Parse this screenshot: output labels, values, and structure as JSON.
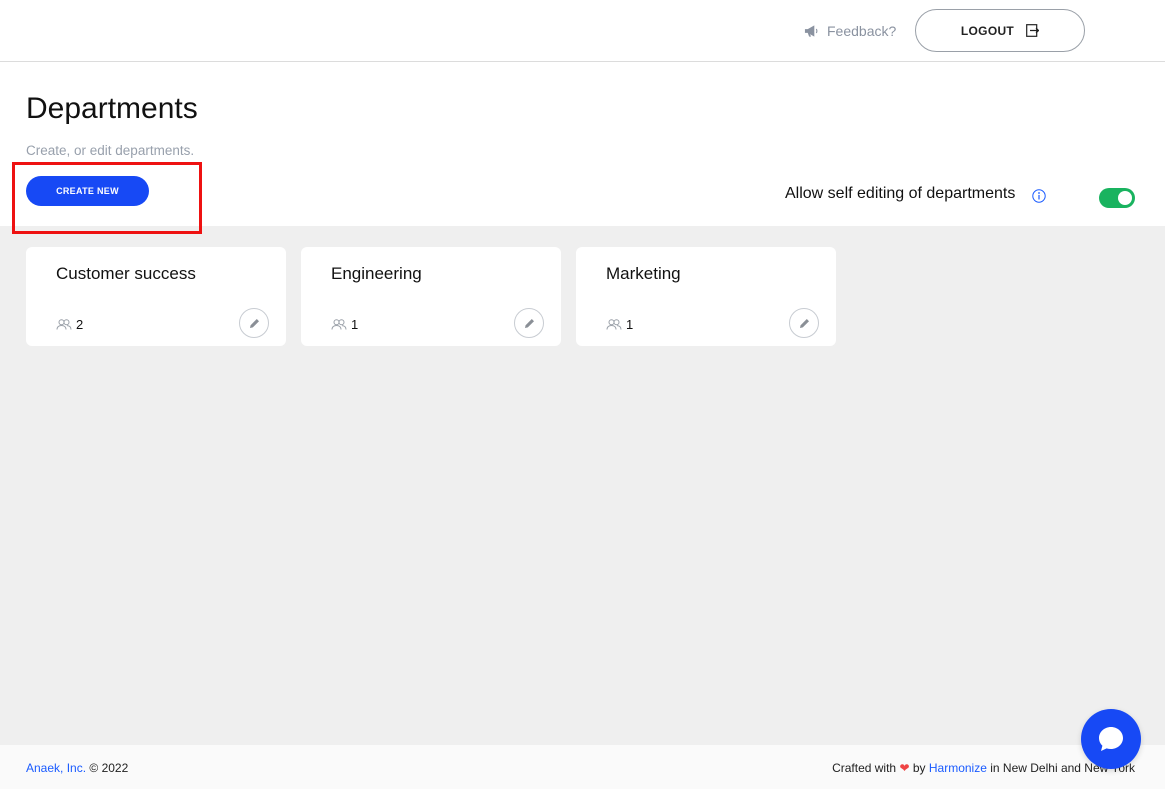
{
  "topbar": {
    "feedback_label": "Feedback?",
    "logout_label": "LOGOUT"
  },
  "header": {
    "title": "Departments",
    "subtitle": "Create, or edit departments.",
    "create_label": "CREATE NEW",
    "self_edit_label": "Allow self editing of departments",
    "self_edit_enabled": true
  },
  "departments": [
    {
      "name": "Customer success",
      "members": "2"
    },
    {
      "name": "Engineering",
      "members": "1"
    },
    {
      "name": "Marketing",
      "members": "1"
    }
  ],
  "footer": {
    "company": "Anaek, Inc.",
    "copyright": "© 2022",
    "crafted_prefix": "Crafted with",
    "heart": "❤",
    "by": "by",
    "brand": "Harmonize",
    "location": "in New Delhi and New York"
  },
  "colors": {
    "primary": "#1749f5",
    "toggle_on": "#19b35f",
    "highlight": "#ee1111",
    "link": "#1a5bff"
  },
  "icons": {
    "feedback": "megaphone-icon",
    "logout": "logout-icon",
    "info": "info-icon",
    "members": "users-icon",
    "edit": "pencil-icon",
    "chat": "chat-bubble-icon"
  }
}
